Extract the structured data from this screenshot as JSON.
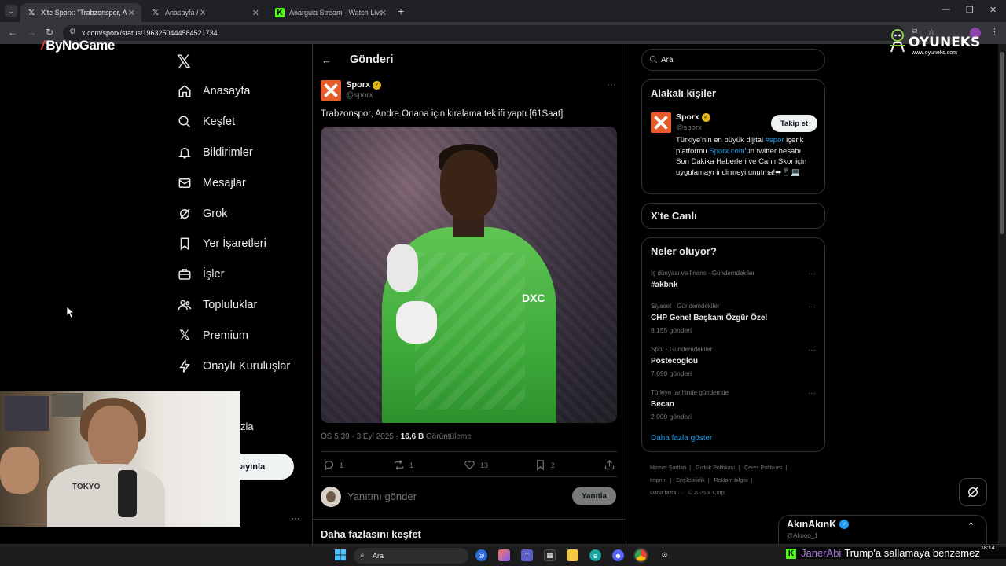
{
  "browser": {
    "tabs": [
      {
        "title": "X'te Sporx: \"Trabzonspor, Andre",
        "icon": "x-icon",
        "active": true
      },
      {
        "title": "Anasayfa / X",
        "icon": "x-icon",
        "active": false
      },
      {
        "title": "Anarguia Stream - Watch Live o",
        "icon": "kick-icon",
        "active": false
      }
    ],
    "url": "x.com/sporx/status/1963250444584521734"
  },
  "overlays": {
    "bynogame": "ByNoGame",
    "oyuneks": "OYUNEKS",
    "oyuneks_sub": "www.oyuneks.com"
  },
  "nav": {
    "items": [
      {
        "label": "Anasayfa",
        "icon": "home-icon"
      },
      {
        "label": "Keşfet",
        "icon": "search-icon"
      },
      {
        "label": "Bildirimler",
        "icon": "bell-icon"
      },
      {
        "label": "Mesajlar",
        "icon": "mail-icon"
      },
      {
        "label": "Grok",
        "icon": "grok-icon"
      },
      {
        "label": "Yer İşaretleri",
        "icon": "bookmark-icon"
      },
      {
        "label": "İşler",
        "icon": "briefcase-icon"
      },
      {
        "label": "Topluluklar",
        "icon": "people-icon"
      },
      {
        "label": "Premium",
        "icon": "x-icon"
      },
      {
        "label": "Onaylı Kuruluşlar",
        "icon": "lightning-icon"
      }
    ],
    "partial_more": "zla",
    "post_button": "ayınla"
  },
  "webcam": {
    "shirt_text": "TOKYO"
  },
  "post": {
    "header": "Gönderi",
    "author_name": "Sporx",
    "author_handle": "@sporx",
    "text": "Trabzonspor, Andre Onana için kiralama teklifi yaptı.[61Saat]",
    "time": "ÖS 5:39 · 3 Eyl 2025 · ",
    "views": "16,6 B",
    "views_label": " Görüntüleme",
    "image_sponsor": "DXC",
    "actions": {
      "replies": "1",
      "reposts": "1",
      "likes": "13",
      "bookmarks": "2"
    },
    "reply_placeholder": "Yanıtını gönder",
    "reply_button": "Yanıtla",
    "discover": "Daha fazlasını keşfet"
  },
  "sidebar": {
    "search_placeholder": "Ara",
    "relevant": {
      "title": "Alakalı kişiler",
      "name": "Sporx",
      "handle": "@sporx",
      "follow": "Takip et",
      "bio_1": "Türkiye'nin en büyük dijital ",
      "bio_tag": "#spor",
      "bio_2": " içerik platformu ",
      "bio_link": "Sporx.com",
      "bio_3": "'un twitter hesabı! Son Dakika Haberleri ve Canlı Skor için uygulamayı indirmeyi unutma!➡📱💻"
    },
    "live_title": "X'te Canlı",
    "trends_title": "Neler oluyor?",
    "trends": [
      {
        "category": "İş dünyası ve finans · Gündemdekiler",
        "name": "#akbnk",
        "count": ""
      },
      {
        "category": "Siyaset · Gündemdekiler",
        "name": "CHP Genel Başkanı Özgür Özel",
        "count": "8.155 gönderi"
      },
      {
        "category": "Spor · Gündemdekiler",
        "name": "Postecoglou",
        "count": "7.690 gönderi"
      },
      {
        "category": "Türkiye tarihinde gündemde",
        "name": "Becao",
        "count": "2.000 gönderi"
      }
    ],
    "show_more": "Daha fazla göster",
    "footer": [
      "Hizmet Şartları",
      "Gizlilik Politikası",
      "Çerez Politikası",
      "Imprint",
      "Erişilebilirlik",
      "Reklam bilgisi",
      "Daha fazla ···",
      "© 2025 X Corp."
    ]
  },
  "messages": {
    "name": "AkınAkınK",
    "handle": "@Akooo_1"
  },
  "taskbar": {
    "search": "Ara",
    "clock": "18:14"
  },
  "ticker": {
    "user": "JanerAbi",
    "text": "Trump'a sallamaya benzemez"
  },
  "colors": {
    "accent": "#1d9bf0",
    "sporx": "#e55b2a",
    "kick": "#53fc18",
    "verified_gold": "#e2b719"
  }
}
